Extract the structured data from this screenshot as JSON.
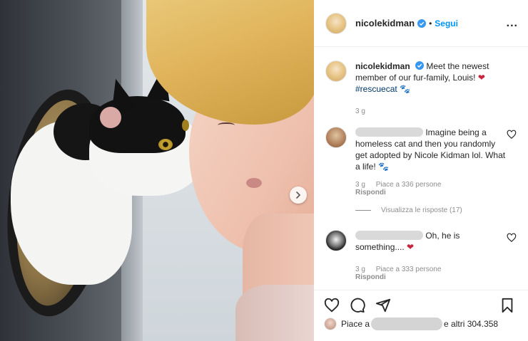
{
  "post": {
    "username": "nicolekidman",
    "follow_label": "Segui",
    "dot": "•",
    "more_label": "...",
    "caption_text": "Meet the newest member of our fur-family, Louis!",
    "caption_heart": "❤",
    "caption_hashtag": "#rescuecat",
    "caption_paw": "🐾",
    "caption_time": "3 g"
  },
  "comments": [
    {
      "text": "Imagine being a homeless cat and then you randomly get adopted by Nicole Kidman lol. What a life!",
      "emoji": "🐾",
      "time": "3 g",
      "likes": "Piace a 336 persone",
      "reply_label": "Rispondi",
      "view_replies": "Visualizza le risposte (17)"
    },
    {
      "text": "Oh, he is something....",
      "emoji": "❤",
      "time": "3 g",
      "likes": "Piace a 333 persone",
      "reply_label": "Rispondi"
    }
  ],
  "likes_bar": {
    "prefix": "Piace a",
    "suffix": "e altri 304.358"
  },
  "colors": {
    "verified": "#3897f0",
    "link": "#0095f6",
    "hashtag": "#00376b",
    "heart": "#c7253e"
  },
  "icons": [
    "verified-badge-icon",
    "more-options-icon",
    "heart-icon",
    "comment-icon",
    "share-icon",
    "bookmark-icon",
    "chevron-right-icon"
  ]
}
